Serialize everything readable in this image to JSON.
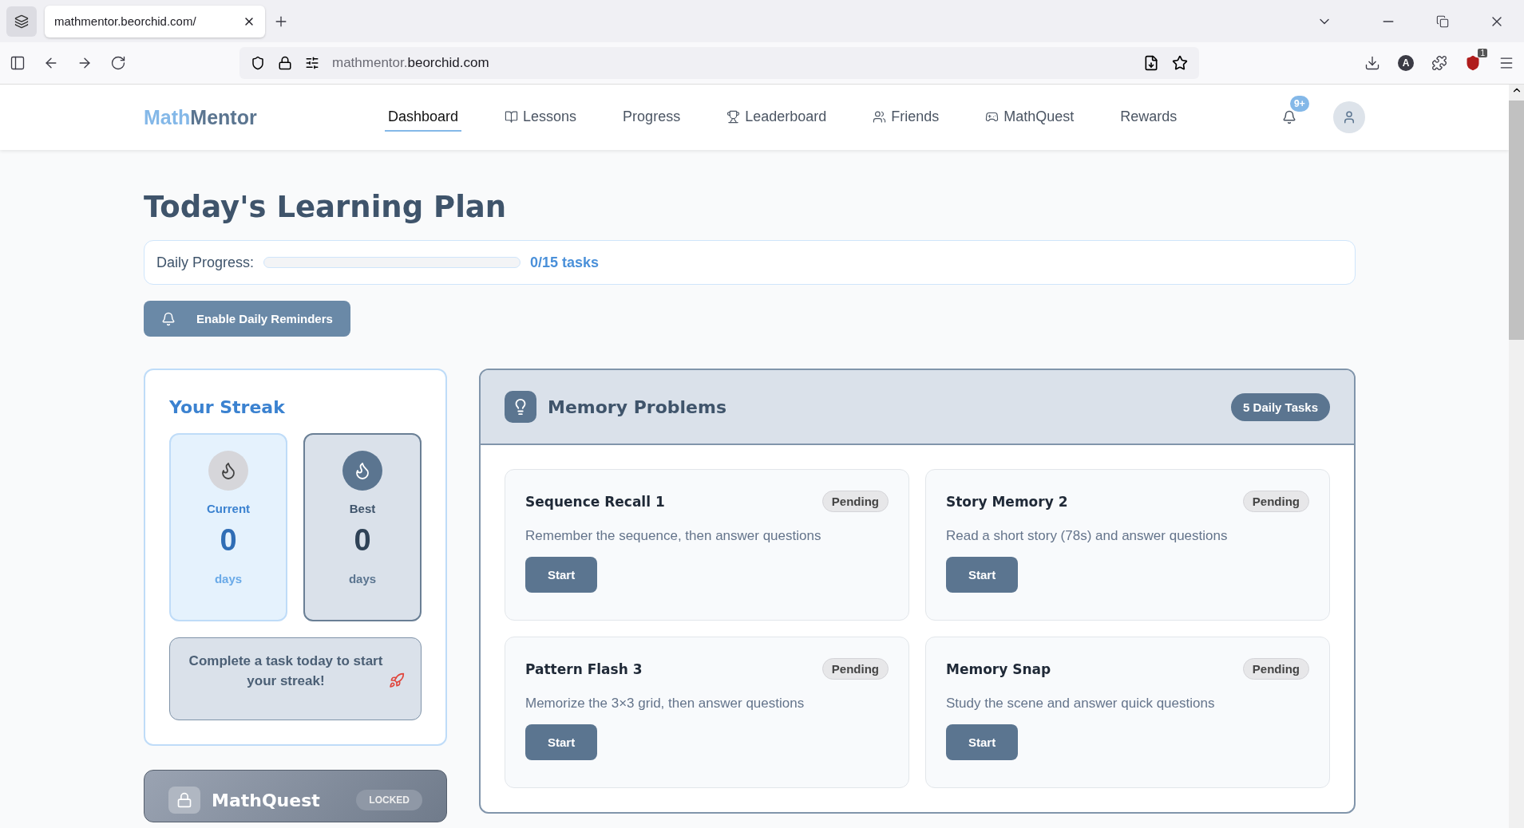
{
  "browser": {
    "tab_title": "mathmentor.beorchid.com/",
    "url_prefix": "mathmentor.",
    "url_domain": "beorchid.com",
    "extension_badge": "1",
    "profile_letter": "A"
  },
  "app": {
    "logo_first": "Math",
    "logo_second": "Mentor",
    "nav": [
      {
        "label": "Dashboard",
        "selected": true
      },
      {
        "label": "Lessons",
        "selected": false
      },
      {
        "label": "Progress",
        "selected": false
      },
      {
        "label": "Leaderboard",
        "selected": false
      },
      {
        "label": "Friends",
        "selected": false
      },
      {
        "label": "MathQuest",
        "selected": false
      },
      {
        "label": "Rewards",
        "selected": false
      }
    ],
    "notification_badge": "9+"
  },
  "page_title": "Today's Learning Plan",
  "daily_progress": {
    "label": "Daily Progress:",
    "level": 0,
    "reading": "0/15 tasks"
  },
  "reminder_button": "Enable Daily Reminders",
  "streak": {
    "title": "Your Streak",
    "boxes": [
      {
        "kind": "current",
        "label": "Current",
        "value": "0",
        "unit": "days"
      },
      {
        "kind": "best",
        "label": "Best",
        "value": "0",
        "unit": "days"
      }
    ],
    "message": "Complete a task today to start your streak!"
  },
  "mathquest_card": {
    "title": "MathQuest",
    "badge": "LOCKED"
  },
  "memory": {
    "title": "Memory Problems",
    "badge": "5 Daily Tasks",
    "tasks": [
      {
        "title": "Sequence Recall 1",
        "status": "Pending",
        "description": "Remember the sequence, then answer questions",
        "button": "Start"
      },
      {
        "title": "Story Memory 2",
        "status": "Pending",
        "description": "Read a short story (78s) and answer questions",
        "button": "Start"
      },
      {
        "title": "Pattern Flash 3",
        "status": "Pending",
        "description": "Memorize the 3×3 grid, then answer questions",
        "button": "Start"
      },
      {
        "title": "Memory Snap",
        "status": "Pending",
        "description": "Study the scene and answer quick questions",
        "button": "Start"
      }
    ]
  }
}
